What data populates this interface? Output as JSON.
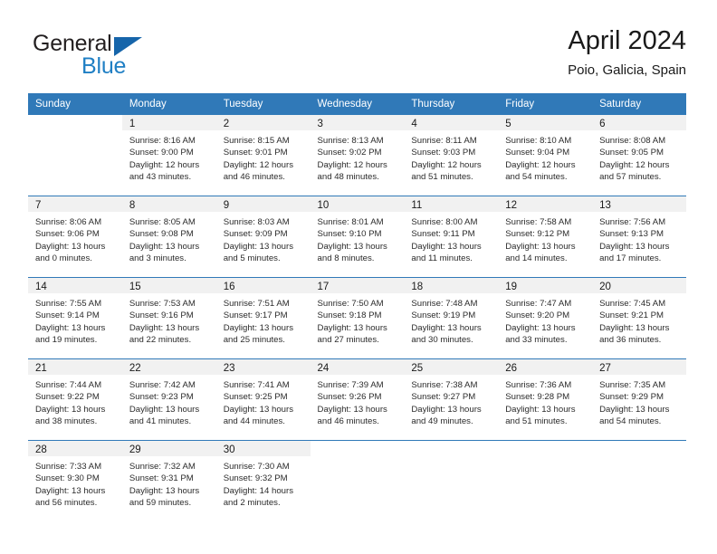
{
  "brand": {
    "name_part1": "General",
    "name_part2": "Blue",
    "triangle_icon": "triangle-logo-icon",
    "colors": {
      "dark": "#231f20",
      "blue": "#1f7fc4",
      "triangle": "#1665aa"
    }
  },
  "header": {
    "title": "April 2024",
    "location": "Poio, Galicia, Spain"
  },
  "theme": {
    "header_bar": "#3079b8",
    "daynum_band": "#f1f1f1",
    "week_separator": "#3079b8",
    "text": "#1a1a1a"
  },
  "weekday_headers": [
    "Sunday",
    "Monday",
    "Tuesday",
    "Wednesday",
    "Thursday",
    "Friday",
    "Saturday"
  ],
  "weeks": [
    [
      {
        "day": "",
        "sunrise": "",
        "sunset": "",
        "daylight1": "",
        "daylight2": ""
      },
      {
        "day": "1",
        "sunrise": "Sunrise: 8:16 AM",
        "sunset": "Sunset: 9:00 PM",
        "daylight1": "Daylight: 12 hours",
        "daylight2": "and 43 minutes."
      },
      {
        "day": "2",
        "sunrise": "Sunrise: 8:15 AM",
        "sunset": "Sunset: 9:01 PM",
        "daylight1": "Daylight: 12 hours",
        "daylight2": "and 46 minutes."
      },
      {
        "day": "3",
        "sunrise": "Sunrise: 8:13 AM",
        "sunset": "Sunset: 9:02 PM",
        "daylight1": "Daylight: 12 hours",
        "daylight2": "and 48 minutes."
      },
      {
        "day": "4",
        "sunrise": "Sunrise: 8:11 AM",
        "sunset": "Sunset: 9:03 PM",
        "daylight1": "Daylight: 12 hours",
        "daylight2": "and 51 minutes."
      },
      {
        "day": "5",
        "sunrise": "Sunrise: 8:10 AM",
        "sunset": "Sunset: 9:04 PM",
        "daylight1": "Daylight: 12 hours",
        "daylight2": "and 54 minutes."
      },
      {
        "day": "6",
        "sunrise": "Sunrise: 8:08 AM",
        "sunset": "Sunset: 9:05 PM",
        "daylight1": "Daylight: 12 hours",
        "daylight2": "and 57 minutes."
      }
    ],
    [
      {
        "day": "7",
        "sunrise": "Sunrise: 8:06 AM",
        "sunset": "Sunset: 9:06 PM",
        "daylight1": "Daylight: 13 hours",
        "daylight2": "and 0 minutes."
      },
      {
        "day": "8",
        "sunrise": "Sunrise: 8:05 AM",
        "sunset": "Sunset: 9:08 PM",
        "daylight1": "Daylight: 13 hours",
        "daylight2": "and 3 minutes."
      },
      {
        "day": "9",
        "sunrise": "Sunrise: 8:03 AM",
        "sunset": "Sunset: 9:09 PM",
        "daylight1": "Daylight: 13 hours",
        "daylight2": "and 5 minutes."
      },
      {
        "day": "10",
        "sunrise": "Sunrise: 8:01 AM",
        "sunset": "Sunset: 9:10 PM",
        "daylight1": "Daylight: 13 hours",
        "daylight2": "and 8 minutes."
      },
      {
        "day": "11",
        "sunrise": "Sunrise: 8:00 AM",
        "sunset": "Sunset: 9:11 PM",
        "daylight1": "Daylight: 13 hours",
        "daylight2": "and 11 minutes."
      },
      {
        "day": "12",
        "sunrise": "Sunrise: 7:58 AM",
        "sunset": "Sunset: 9:12 PM",
        "daylight1": "Daylight: 13 hours",
        "daylight2": "and 14 minutes."
      },
      {
        "day": "13",
        "sunrise": "Sunrise: 7:56 AM",
        "sunset": "Sunset: 9:13 PM",
        "daylight1": "Daylight: 13 hours",
        "daylight2": "and 17 minutes."
      }
    ],
    [
      {
        "day": "14",
        "sunrise": "Sunrise: 7:55 AM",
        "sunset": "Sunset: 9:14 PM",
        "daylight1": "Daylight: 13 hours",
        "daylight2": "and 19 minutes."
      },
      {
        "day": "15",
        "sunrise": "Sunrise: 7:53 AM",
        "sunset": "Sunset: 9:16 PM",
        "daylight1": "Daylight: 13 hours",
        "daylight2": "and 22 minutes."
      },
      {
        "day": "16",
        "sunrise": "Sunrise: 7:51 AM",
        "sunset": "Sunset: 9:17 PM",
        "daylight1": "Daylight: 13 hours",
        "daylight2": "and 25 minutes."
      },
      {
        "day": "17",
        "sunrise": "Sunrise: 7:50 AM",
        "sunset": "Sunset: 9:18 PM",
        "daylight1": "Daylight: 13 hours",
        "daylight2": "and 27 minutes."
      },
      {
        "day": "18",
        "sunrise": "Sunrise: 7:48 AM",
        "sunset": "Sunset: 9:19 PM",
        "daylight1": "Daylight: 13 hours",
        "daylight2": "and 30 minutes."
      },
      {
        "day": "19",
        "sunrise": "Sunrise: 7:47 AM",
        "sunset": "Sunset: 9:20 PM",
        "daylight1": "Daylight: 13 hours",
        "daylight2": "and 33 minutes."
      },
      {
        "day": "20",
        "sunrise": "Sunrise: 7:45 AM",
        "sunset": "Sunset: 9:21 PM",
        "daylight1": "Daylight: 13 hours",
        "daylight2": "and 36 minutes."
      }
    ],
    [
      {
        "day": "21",
        "sunrise": "Sunrise: 7:44 AM",
        "sunset": "Sunset: 9:22 PM",
        "daylight1": "Daylight: 13 hours",
        "daylight2": "and 38 minutes."
      },
      {
        "day": "22",
        "sunrise": "Sunrise: 7:42 AM",
        "sunset": "Sunset: 9:23 PM",
        "daylight1": "Daylight: 13 hours",
        "daylight2": "and 41 minutes."
      },
      {
        "day": "23",
        "sunrise": "Sunrise: 7:41 AM",
        "sunset": "Sunset: 9:25 PM",
        "daylight1": "Daylight: 13 hours",
        "daylight2": "and 44 minutes."
      },
      {
        "day": "24",
        "sunrise": "Sunrise: 7:39 AM",
        "sunset": "Sunset: 9:26 PM",
        "daylight1": "Daylight: 13 hours",
        "daylight2": "and 46 minutes."
      },
      {
        "day": "25",
        "sunrise": "Sunrise: 7:38 AM",
        "sunset": "Sunset: 9:27 PM",
        "daylight1": "Daylight: 13 hours",
        "daylight2": "and 49 minutes."
      },
      {
        "day": "26",
        "sunrise": "Sunrise: 7:36 AM",
        "sunset": "Sunset: 9:28 PM",
        "daylight1": "Daylight: 13 hours",
        "daylight2": "and 51 minutes."
      },
      {
        "day": "27",
        "sunrise": "Sunrise: 7:35 AM",
        "sunset": "Sunset: 9:29 PM",
        "daylight1": "Daylight: 13 hours",
        "daylight2": "and 54 minutes."
      }
    ],
    [
      {
        "day": "28",
        "sunrise": "Sunrise: 7:33 AM",
        "sunset": "Sunset: 9:30 PM",
        "daylight1": "Daylight: 13 hours",
        "daylight2": "and 56 minutes."
      },
      {
        "day": "29",
        "sunrise": "Sunrise: 7:32 AM",
        "sunset": "Sunset: 9:31 PM",
        "daylight1": "Daylight: 13 hours",
        "daylight2": "and 59 minutes."
      },
      {
        "day": "30",
        "sunrise": "Sunrise: 7:30 AM",
        "sunset": "Sunset: 9:32 PM",
        "daylight1": "Daylight: 14 hours",
        "daylight2": "and 2 minutes."
      },
      {
        "day": "",
        "sunrise": "",
        "sunset": "",
        "daylight1": "",
        "daylight2": ""
      },
      {
        "day": "",
        "sunrise": "",
        "sunset": "",
        "daylight1": "",
        "daylight2": ""
      },
      {
        "day": "",
        "sunrise": "",
        "sunset": "",
        "daylight1": "",
        "daylight2": ""
      },
      {
        "day": "",
        "sunrise": "",
        "sunset": "",
        "daylight1": "",
        "daylight2": ""
      }
    ]
  ]
}
